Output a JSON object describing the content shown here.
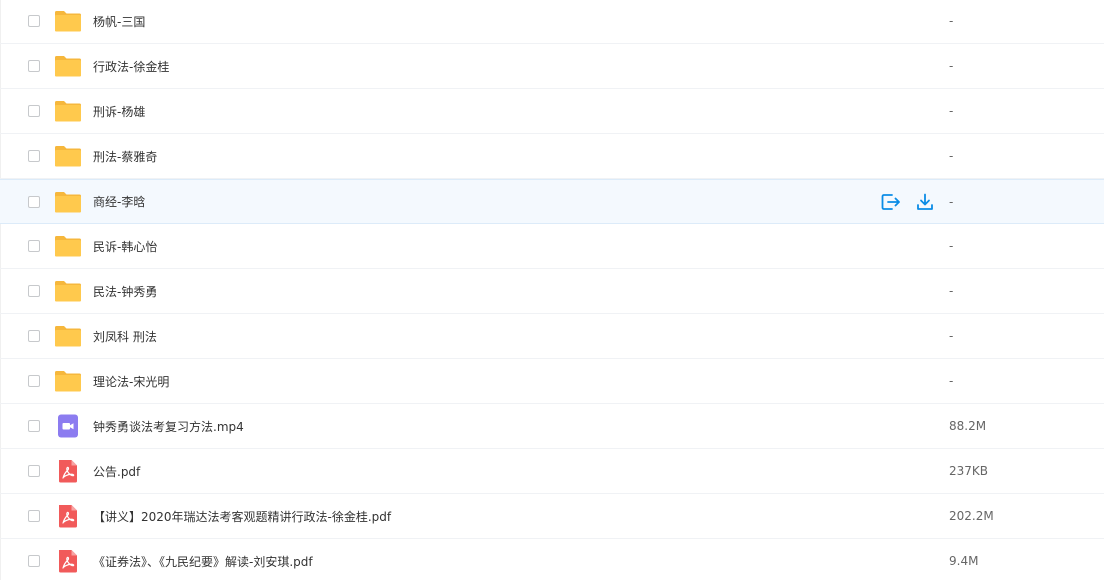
{
  "colors": {
    "folder": "#ffc94d",
    "folder_dark": "#f6b73c",
    "pdf": "#f15a5a",
    "video": "#8c7cf0",
    "action_blue": "#0a8ce6",
    "hover_bg": "#f4f9fe"
  },
  "rows": [
    {
      "type": "folder",
      "name": "杨帆-三国",
      "size": "-"
    },
    {
      "type": "folder",
      "name": "行政法-徐金桂",
      "size": "-"
    },
    {
      "type": "folder",
      "name": "刑诉-杨雄",
      "size": "-"
    },
    {
      "type": "folder",
      "name": "刑法-蔡雅奇",
      "size": "-"
    },
    {
      "type": "folder",
      "name": "商经-李晗",
      "size": "-",
      "hovered": true,
      "actions": [
        "share-icon",
        "download-icon"
      ]
    },
    {
      "type": "folder",
      "name": "民诉-韩心怡",
      "size": "-"
    },
    {
      "type": "folder",
      "name": "民法-钟秀勇",
      "size": "-"
    },
    {
      "type": "folder",
      "name": "刘凤科 刑法",
      "size": "-"
    },
    {
      "type": "folder",
      "name": "理论法-宋光明",
      "size": "-"
    },
    {
      "type": "video",
      "name": "钟秀勇谈法考复习方法.mp4",
      "size": "88.2M"
    },
    {
      "type": "pdf",
      "name": "公告.pdf",
      "size": "237KB"
    },
    {
      "type": "pdf",
      "name": "【讲义】2020年瑞达法考客观题精讲行政法-徐金桂.pdf",
      "size": "202.2M"
    },
    {
      "type": "pdf",
      "name": "《证券法》、《九民纪要》解读-刘安琪.pdf",
      "size": "9.4M"
    }
  ]
}
